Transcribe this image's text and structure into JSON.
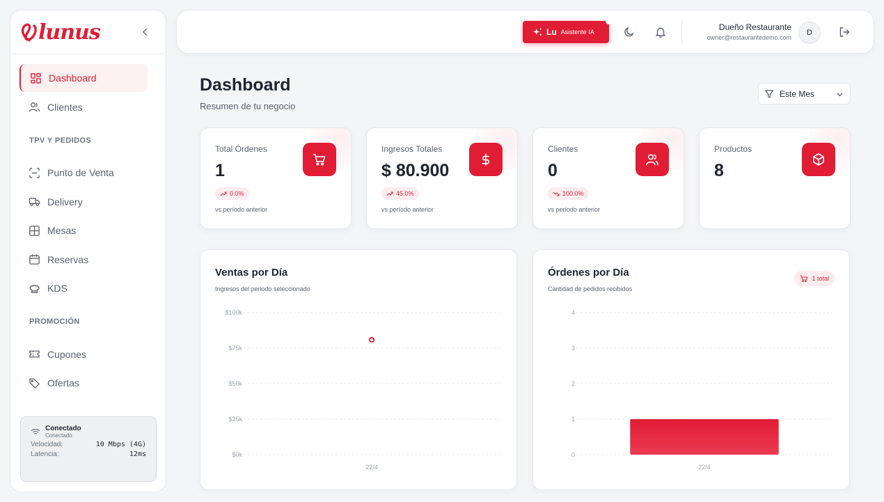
{
  "brand": {
    "logo_text": "lunus"
  },
  "sidebar": {
    "dashboard": "Dashboard",
    "clientes": "Clientes",
    "section_tpv": "TPV Y PEDIDOS",
    "punto_venta": "Punto de Venta",
    "delivery": "Delivery",
    "mesas": "Mesas",
    "reservas": "Reservas",
    "kds": "KDS",
    "section_promo": "PROMOCIÓN",
    "cupones": "Cupones",
    "ofertas": "Ofertas"
  },
  "connection": {
    "title": "Conectado",
    "subtitle": "Conectado",
    "speed_label": "Velocidad:",
    "speed_value": "10 Mbps (4G)",
    "latency_label": "Latencia:",
    "latency_value": "12ms"
  },
  "header": {
    "ai_short": "Lu",
    "ai_label": "Asistente IA",
    "user_name": "Dueño Restaurante",
    "user_email": "owner@restaurantedemo.com",
    "avatar_initial": "D"
  },
  "page": {
    "title": "Dashboard",
    "subtitle": "Resumen de tu negocio",
    "filter_label": "Este Mes"
  },
  "stats": [
    {
      "label": "Total Órdenes",
      "value": "1",
      "trend": "0.0%",
      "note": "vs período anterior",
      "icon": "cart-icon"
    },
    {
      "label": "Ingresos Totales",
      "value": "$ 80.900",
      "trend": "45.0%",
      "note": "vs período anterior",
      "icon": "dollar-icon"
    },
    {
      "label": "Clientes",
      "value": "0",
      "trend": "100.0%",
      "note": "vs período anterior",
      "icon": "users-icon"
    },
    {
      "label": "Productos",
      "value": "8",
      "icon": "box-icon"
    }
  ],
  "colors": {
    "accent": "#e11d36",
    "accent_soft": "#fdecee"
  },
  "chart_data": [
    {
      "type": "scatter",
      "title": "Ventas por Día",
      "subtitle": "Ingresos del periodo seleccionado",
      "categories": [
        "22/4"
      ],
      "values": [
        80900
      ],
      "ylim": [
        0,
        100000
      ],
      "yticks": [
        "$100k",
        "$75k",
        "$50k",
        "$25k",
        "$0k"
      ],
      "grid": true
    },
    {
      "type": "bar",
      "title": "Órdenes por Día",
      "subtitle": "Cantidad de pedidos recibidos",
      "badge": "1 total",
      "categories": [
        "22/4"
      ],
      "values": [
        1
      ],
      "ylim": [
        0,
        4
      ],
      "yticks": [
        "4",
        "3",
        "2",
        "1",
        "0"
      ],
      "grid": true
    }
  ]
}
